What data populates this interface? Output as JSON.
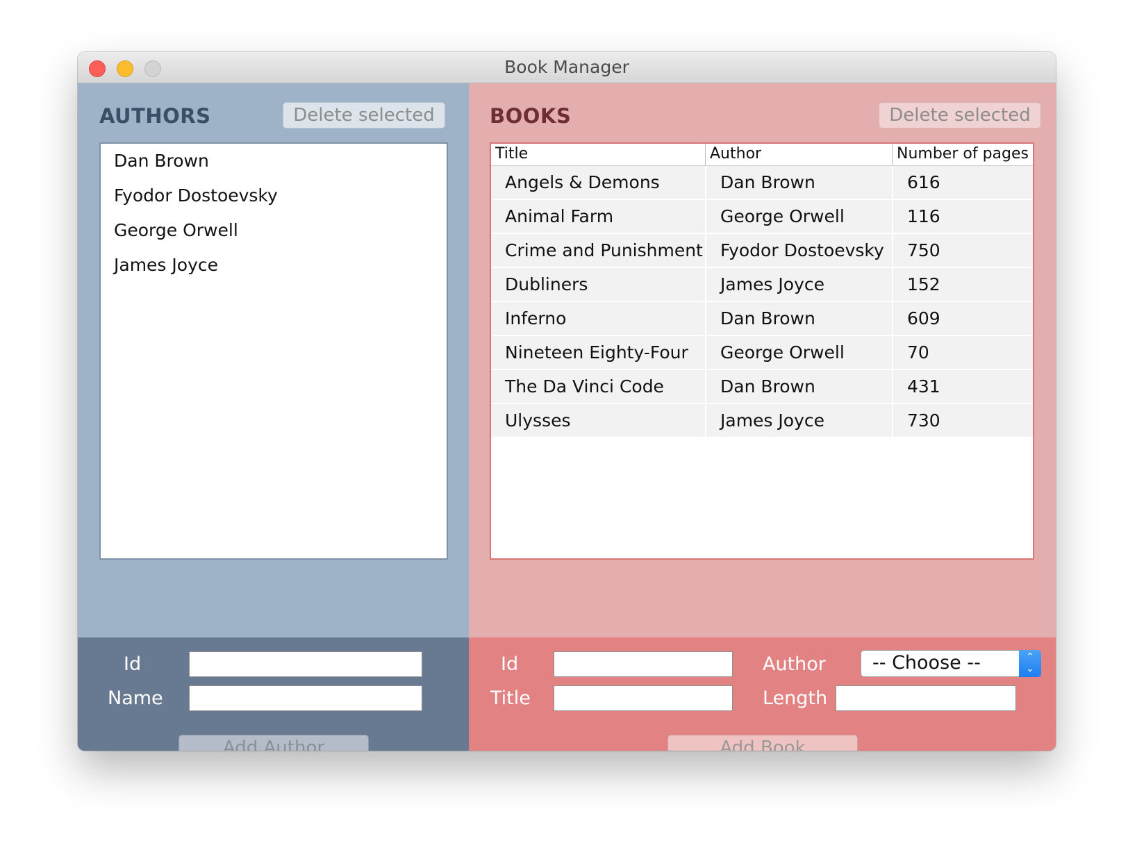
{
  "window": {
    "title": "Book Manager"
  },
  "authors": {
    "title": "AUTHORS",
    "delete_label": "Delete selected",
    "items": [
      "Dan Brown",
      "Fyodor Dostoevsky",
      "George Orwell",
      "James Joyce"
    ]
  },
  "books": {
    "title": "BOOKS",
    "delete_label": "Delete selected",
    "columns": [
      "Title",
      "Author",
      "Number of pages"
    ],
    "rows": [
      [
        "Angels & Demons",
        "Dan Brown",
        "616"
      ],
      [
        "Animal Farm",
        "George Orwell",
        "116"
      ],
      [
        "Crime and Punishment",
        "Fyodor Dostoevsky",
        "750"
      ],
      [
        "Dubliners",
        "James Joyce",
        "152"
      ],
      [
        "Inferno",
        "Dan Brown",
        "609"
      ],
      [
        "Nineteen Eighty-Four",
        "George Orwell",
        "70"
      ],
      [
        "The Da Vinci Code",
        "Dan Brown",
        "431"
      ],
      [
        "Ulysses",
        "James Joyce",
        "730"
      ]
    ]
  },
  "author_form": {
    "id_label": "Id",
    "name_label": "Name",
    "id_value": "",
    "name_value": "",
    "add_label": "Add Author"
  },
  "book_form": {
    "id_label": "Id",
    "title_label": "Title",
    "author_label": "Author",
    "length_label": "Length",
    "id_value": "",
    "title_value": "",
    "length_value": "",
    "author_selected": "-- Choose --",
    "add_label": "Add Book"
  },
  "colors": {
    "authors_panel": "#9fb3c8",
    "authors_form": "#687a91",
    "books_panel": "#e5aeae",
    "books_form": "#e28282",
    "select_accent": "#2b8bf2"
  }
}
